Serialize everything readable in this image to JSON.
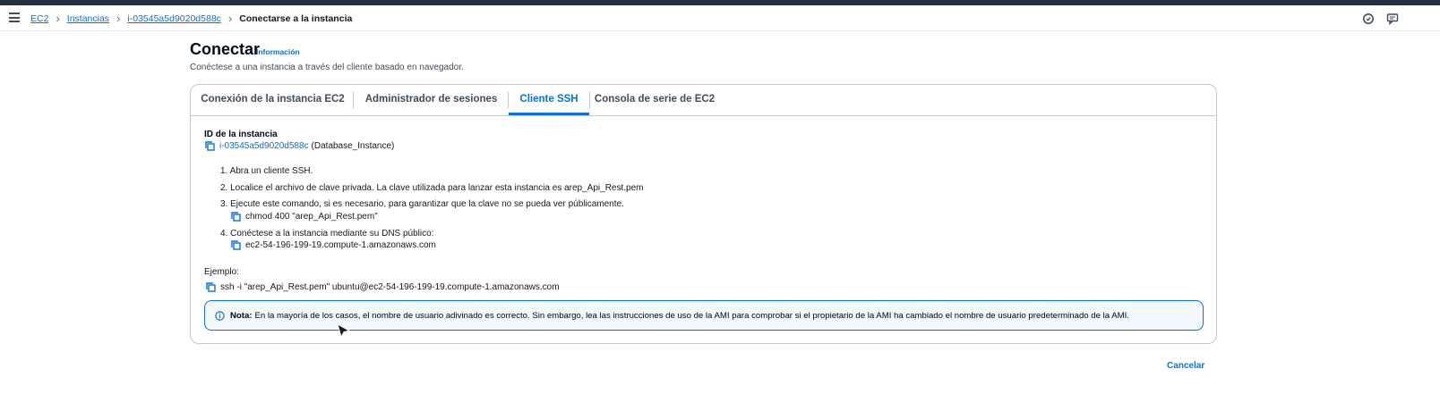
{
  "breadcrumbs": {
    "items": [
      "EC2",
      "Instancias",
      "i-03545a5d9020d588c"
    ],
    "current": "Conectarse a la instancia"
  },
  "icons": {
    "menu": "hamburger-menu-icon",
    "notifications": "notifications-icon",
    "feedback": "feedback-icon",
    "copy": "copy-icon",
    "info": "info-circle-icon",
    "breadcrumb_separator": "chevron-right-icon"
  },
  "header": {
    "title": "Conectar",
    "info_link": "Información",
    "description": "Conéctese a una instancia a través del cliente basado en navegador."
  },
  "tabs": [
    {
      "label": "Conexión de la instancia EC2",
      "active": false
    },
    {
      "label": "Administrador de sesiones",
      "active": false
    },
    {
      "label": "Cliente SSH",
      "active": true
    },
    {
      "label": "Consola de serie de EC2",
      "active": false
    }
  ],
  "instance": {
    "label": "ID de la instancia",
    "id": "i-03545a5d9020d588c",
    "name": "(Database_Instance)"
  },
  "steps": [
    "1. Abra un cliente SSH.",
    "2. Localice el archivo de clave privada. La clave utilizada para lanzar esta instancia es arep_Api_Rest.pem",
    "3. Ejecute este comando, si es necesario, para garantizar que la clave no se pueda ver públicamente.",
    "4. Conéctese a la instancia mediante su DNS público:"
  ],
  "commands": {
    "chmod": "chmod 400 \"arep_Api_Rest.pem\"",
    "dns": "ec2-54-196-199-19.compute-1.amazonaws.com"
  },
  "example": {
    "label": "Ejemplo:",
    "command": "ssh -i \"arep_Api_Rest.pem\" ubuntu@ec2-54-196-199-19.compute-1.amazonaws.com"
  },
  "note": {
    "prefix": "Nota:",
    "text": "En la mayoría de los casos, el nombre de usuario adivinado es correcto. Sin embargo, lea las instrucciones de uso de la AMI para comprobar si el propietario de la AMI ha cambiado el nombre de usuario predeterminado de la AMI."
  },
  "actions": {
    "cancel": "Cancelar"
  },
  "colors": {
    "link": "#0972d3",
    "topbar": "#232f3e",
    "note_bg": "#f2f8fd",
    "border": "#c6c6cd"
  }
}
